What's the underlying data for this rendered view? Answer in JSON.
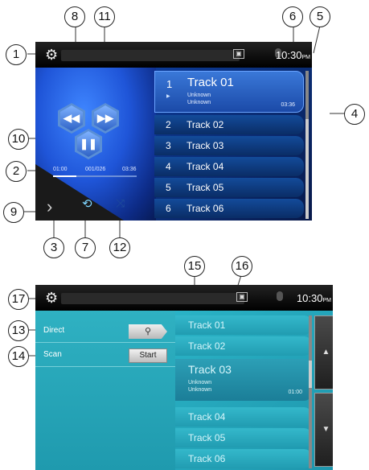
{
  "callouts": [
    "1",
    "2",
    "3",
    "4",
    "5",
    "6",
    "7",
    "8",
    "9",
    "10",
    "11",
    "12",
    "13",
    "14",
    "15",
    "16",
    "17"
  ],
  "statusbar": {
    "time": "10:30",
    "ampm": "PM",
    "car_icon": "car-icon",
    "bluetooth_icon": "bluetooth-icon",
    "settings_icon": "gear-icon"
  },
  "player": {
    "elapsed": "01:00",
    "track_counter": "001/026",
    "duration": "03:36",
    "progress": 0.28,
    "prev_icon": "skip-previous-icon",
    "next_icon": "skip-next-icon",
    "pause_icon": "pause-icon",
    "repeat_icon": "repeat-icon",
    "shuffle_icon": "shuffle-icon",
    "back_icon": "chevron-left-icon"
  },
  "tracklist1": {
    "active": {
      "num": "1",
      "name": "Track 01",
      "artist": "Unknown",
      "album": "Unknown",
      "time": "03:36"
    },
    "rows": [
      {
        "num": "2",
        "name": "Track 02"
      },
      {
        "num": "3",
        "name": "Track 03"
      },
      {
        "num": "4",
        "name": "Track 04"
      },
      {
        "num": "5",
        "name": "Track 05"
      },
      {
        "num": "6",
        "name": "Track 06"
      }
    ]
  },
  "search_panel": {
    "direct_label": "Direct",
    "scan_label": "Scan",
    "search_icon": "search-icon",
    "start_label": "Start"
  },
  "tracklist2": {
    "rows_before": [
      {
        "name": "Track 01"
      },
      {
        "name": "Track 02"
      }
    ],
    "active": {
      "name": "Track 03",
      "artist": "Unknown",
      "album": "Unknown",
      "time": "01:00"
    },
    "rows_after": [
      {
        "name": "Track 04"
      },
      {
        "name": "Track 05"
      },
      {
        "name": "Track 06"
      }
    ]
  },
  "colors": {
    "player_blue": "#1f55d8",
    "scan_teal": "#2fb1c2"
  }
}
